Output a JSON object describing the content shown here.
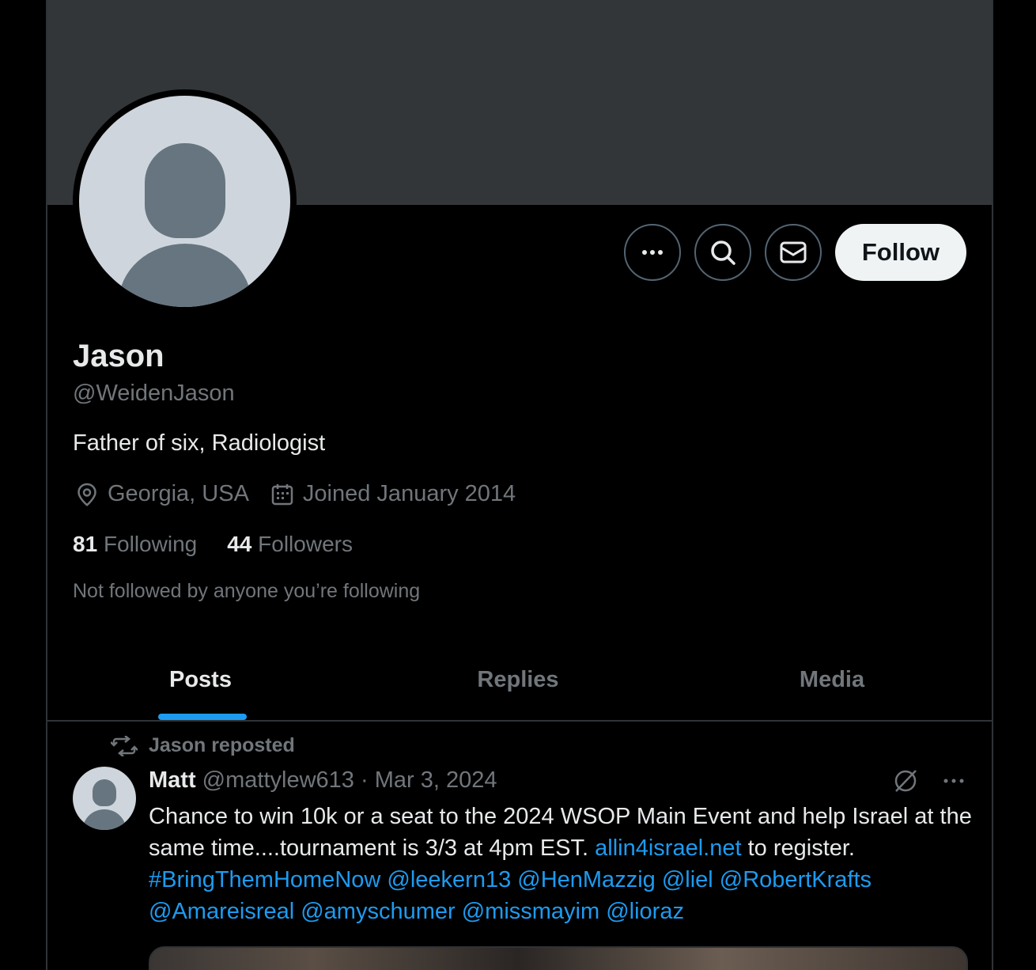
{
  "profile": {
    "name": "Jason",
    "handle": "@WeidenJason",
    "bio": "Father of six, Radiologist",
    "location": "Georgia, USA",
    "joined": "Joined January 2014",
    "following_count": "81",
    "following_label": "Following",
    "followers_count": "44",
    "followers_label": "Followers",
    "not_followed_text": "Not followed by anyone you’re following"
  },
  "actions": {
    "follow_label": "Follow",
    "more_icon": "more-horizontal-icon",
    "search_icon": "search-icon",
    "message_icon": "envelope-icon"
  },
  "tabs": [
    {
      "label": "Posts",
      "active": true
    },
    {
      "label": "Replies",
      "active": false
    },
    {
      "label": "Media",
      "active": false
    }
  ],
  "post": {
    "repost_label": "Jason reposted",
    "author_name": "Matt",
    "author_handle": "@mattylew613",
    "separator": "·",
    "date": "Mar 3, 2024",
    "text_part1": "Chance to win 10k or a seat to the 2024 WSOP Main Event and help Israel at the same time....tournament is 3/3 at 4pm EST. ",
    "link_url": "allin4israel.net",
    "text_part2": " to register.",
    "hashtag": "#BringThemHomeNow",
    "mentions": [
      "@leekern13",
      "@HenMazzig",
      "@liel",
      "@RobertKrafts",
      "@Amareisreal",
      "@amyschumer",
      "@missmayim",
      "@lioraz"
    ]
  },
  "colors": {
    "accent": "#1d9bf0",
    "banner": "#333639",
    "muted": "#71767b"
  }
}
